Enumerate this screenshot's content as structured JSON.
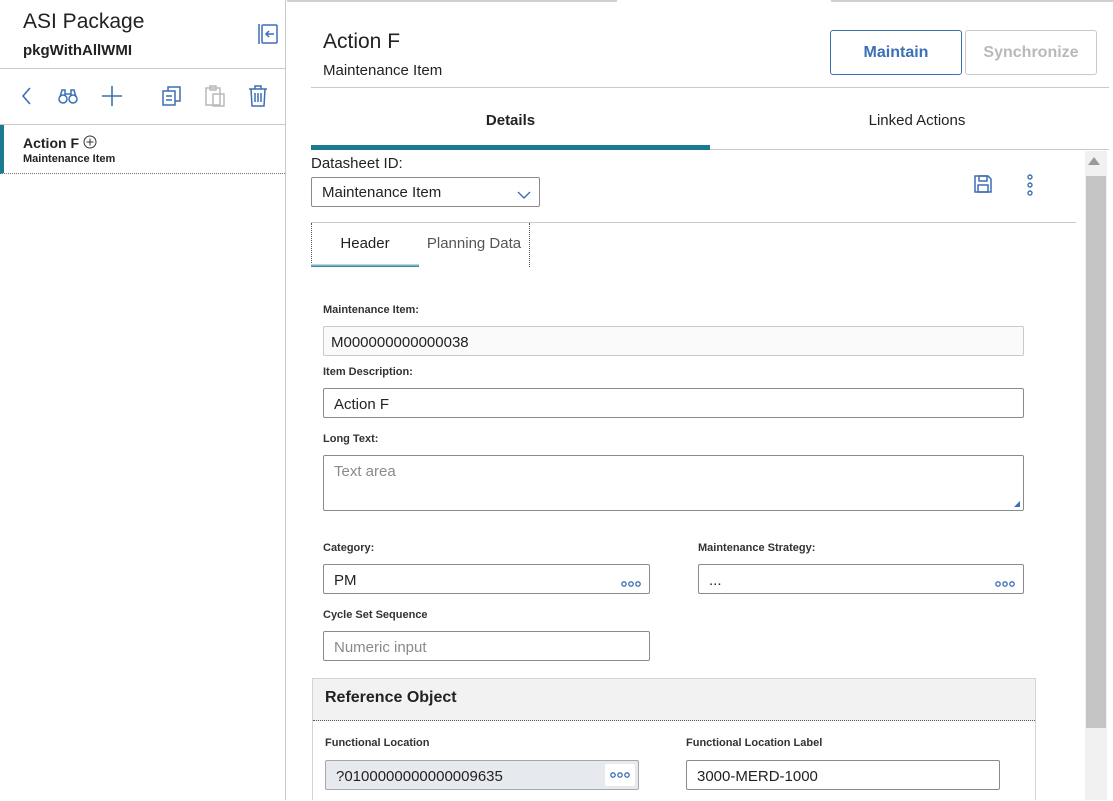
{
  "left_panel": {
    "title": "ASI Package",
    "subtitle": "pkgWithAllWMI",
    "tree": {
      "item_title": "Action F",
      "item_subtitle": "Maintenance Item"
    }
  },
  "record": {
    "title": "Action F",
    "subtitle": "Maintenance Item",
    "maintain_label": "Maintain",
    "synchronize_label": "Synchronize"
  },
  "tabs": {
    "details": "Details",
    "linked_actions": "Linked Actions"
  },
  "datasheet": {
    "label": "Datasheet ID:",
    "selected": "Maintenance Item"
  },
  "sub_tabs": {
    "header": "Header",
    "planning": "Planning Data"
  },
  "form": {
    "maintenance_item_label": "Maintenance Item:",
    "maintenance_item_value": "M000000000000038",
    "item_description_label": "Item Description:",
    "item_description_value": "Action F",
    "long_text_label": "Long Text:",
    "long_text_placeholder": "Text area",
    "category_label": "Category:",
    "category_value": "PM",
    "strategy_label": "Maintenance Strategy:",
    "strategy_value": "...",
    "cycle_label": "Cycle Set Sequence",
    "cycle_placeholder": "Numeric input"
  },
  "reference": {
    "title": "Reference Object",
    "fl_label": "Functional Location",
    "fl_value": "?0100000000000009635",
    "fl_label_label": "Functional Location Label",
    "fl_label_value": "3000-MERD-1000"
  },
  "colors": {
    "accent": "#1a7a91",
    "primary_button": "#3b6fb6"
  }
}
